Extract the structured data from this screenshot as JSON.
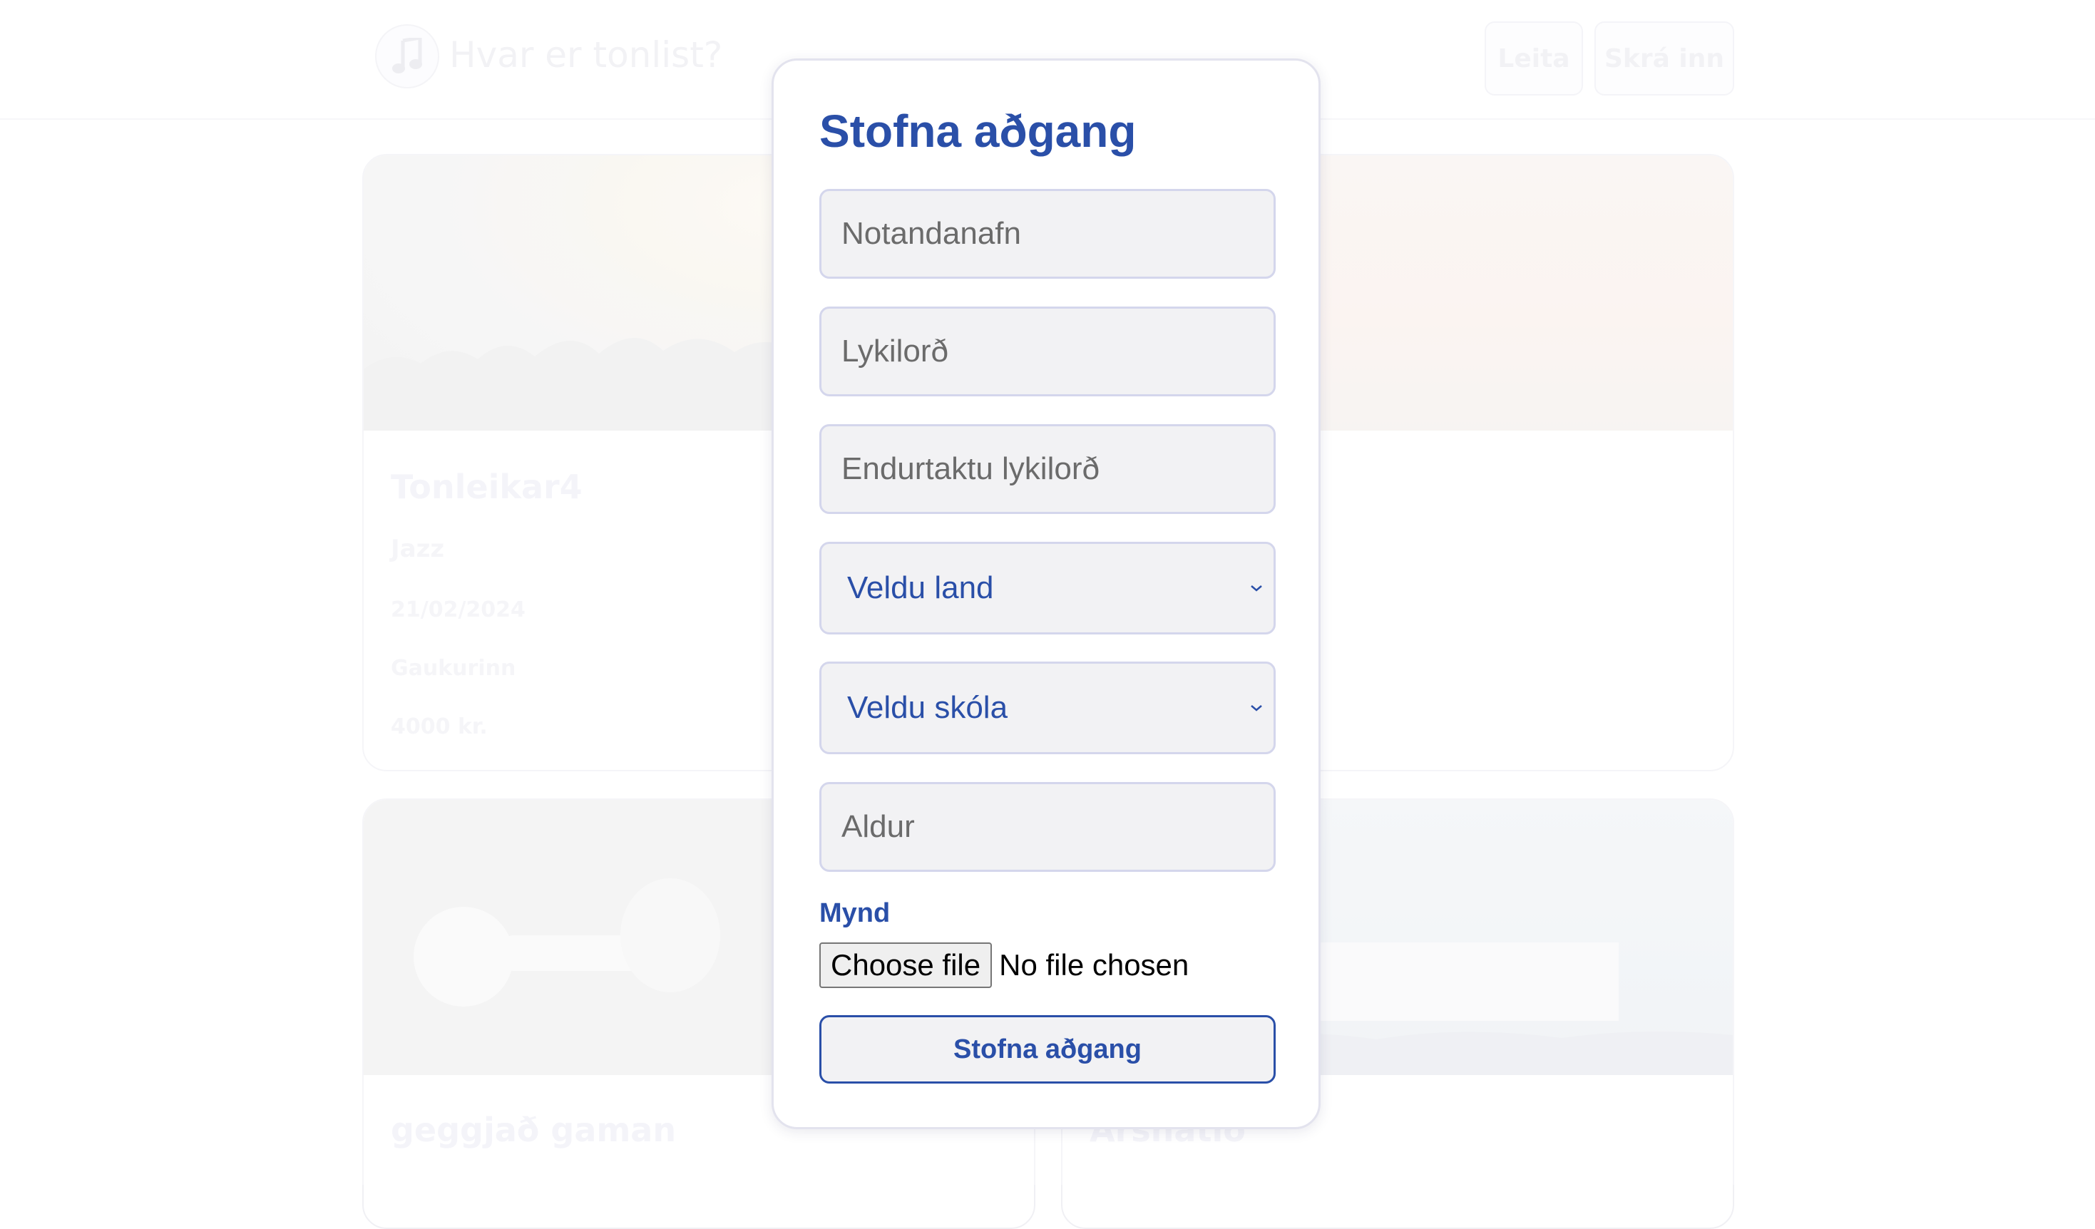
{
  "background": {
    "brand": {
      "title": "Hvar er tonlist?",
      "logo_icon": "music-note-icon"
    },
    "nav": {
      "search_label": "Leita",
      "login_label": "Skrá inn"
    },
    "cards": [
      {
        "title": "Tonleikar4",
        "genre": "Jazz",
        "date": "21/02/2024",
        "venue": "Gaukurinn",
        "price": "4000 kr."
      },
      {
        "title": "",
        "genre": "",
        "date": "",
        "venue": "",
        "price": ""
      },
      {
        "title": "geggjað gaman"
      },
      {
        "title": "Árshátíð"
      }
    ]
  },
  "signup_modal": {
    "title": "Stofna aðgang",
    "username_placeholder": "Notandanafn",
    "password_placeholder": "Lykilorð",
    "repeat_password_placeholder": "Endurtaktu lykilorð",
    "country_select": {
      "selected": "Veldu land"
    },
    "school_select": {
      "selected": "Veldu skóla"
    },
    "age_placeholder": "Aldur",
    "image_label": "Mynd",
    "file_button_label": "Choose file",
    "file_status": "No file chosen",
    "submit_label": "Stofna aðgang"
  },
  "colors": {
    "accent": "#2a4fa8",
    "field_bg": "#f2f2f4",
    "field_border": "#d4d6ec"
  }
}
